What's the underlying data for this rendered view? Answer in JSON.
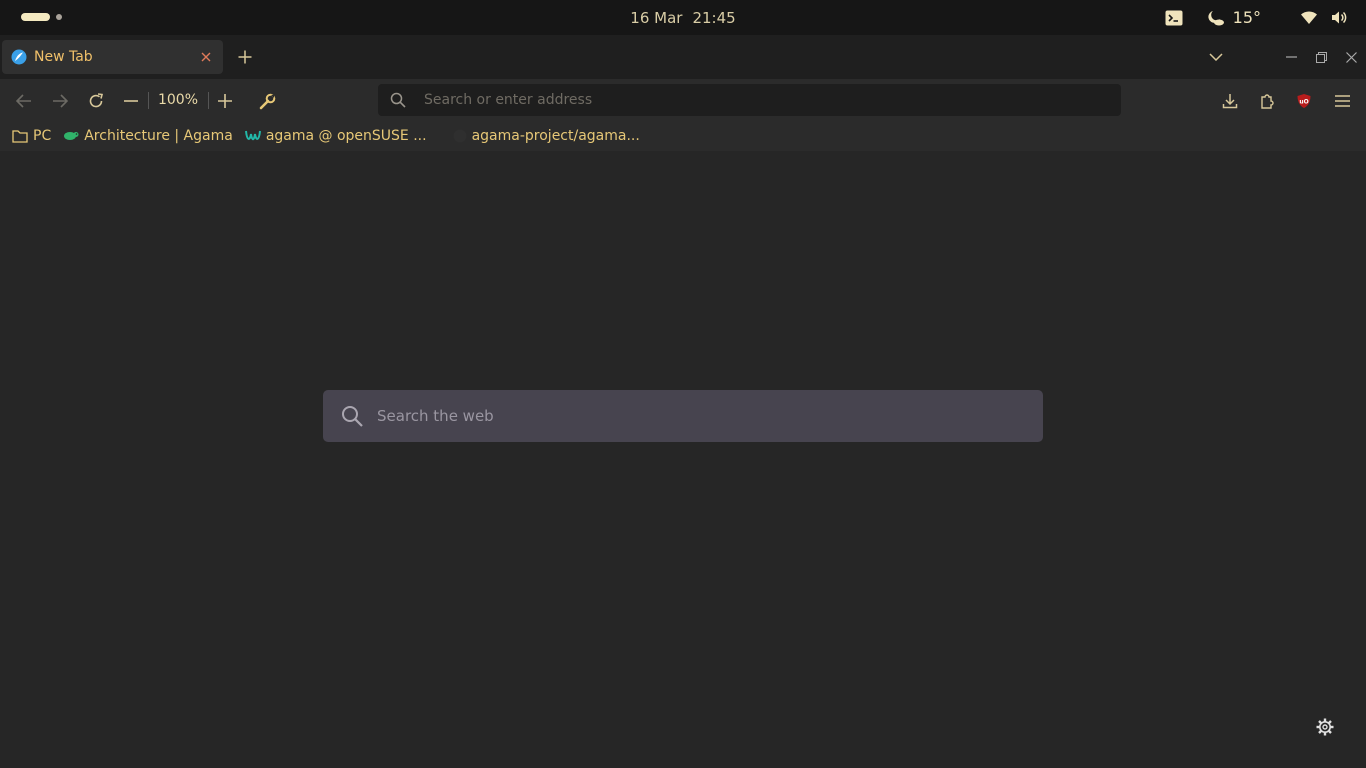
{
  "system": {
    "date": "16 Mar",
    "time": "21:45",
    "temperature": "15°"
  },
  "browser": {
    "tab": {
      "title": "New Tab"
    },
    "zoom": "100%",
    "urlbar": {
      "placeholder": "Search or enter address"
    },
    "bookmarks": [
      {
        "label": "PC",
        "icon": "folder-icon"
      },
      {
        "label": "Architecture | Agama",
        "icon": "chameleon-icon"
      },
      {
        "label": "agama @ openSUSE ...",
        "icon": "weblate-icon"
      },
      {
        "label": "agama-project/agama...",
        "icon": "github-icon"
      }
    ]
  },
  "page": {
    "search": {
      "placeholder": "Search the web"
    }
  },
  "colors": {
    "accent": "#f0c06a",
    "background": "#262626",
    "searchbox": "#47444f",
    "ublock": "#b71c1c"
  }
}
